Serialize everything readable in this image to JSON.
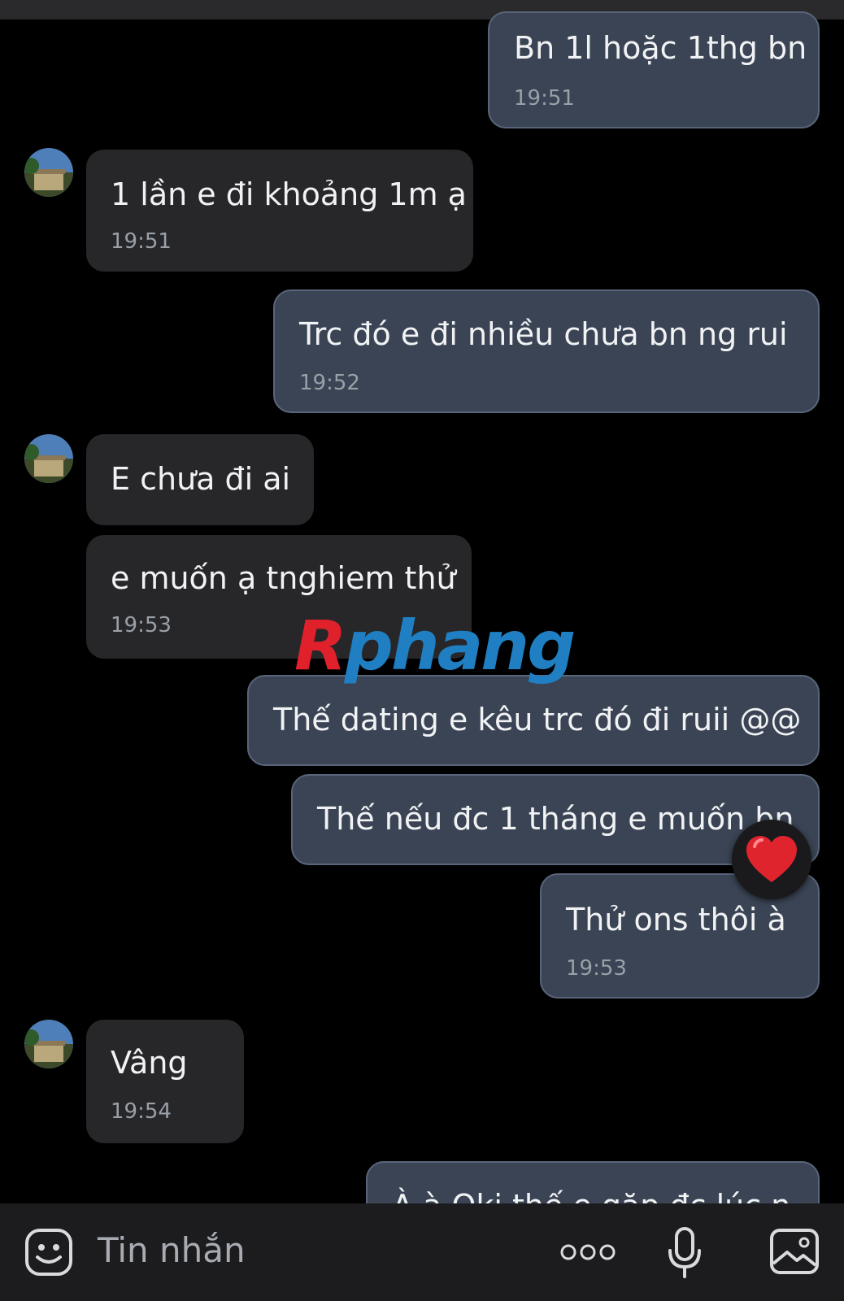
{
  "messages": [
    {
      "dir": "out",
      "text": "Bn 1l hoặc 1thg bn",
      "time": "19:51"
    },
    {
      "dir": "in",
      "text": "1 lần e đi khoảng 1m ạ",
      "time": "19:51"
    },
    {
      "dir": "out",
      "text": "Trc đó e đi nhiều chưa bn ng rui",
      "time": "19:52"
    },
    {
      "dir": "in",
      "text": "E chưa đi ai",
      "time": ""
    },
    {
      "dir": "in",
      "text": "e muốn ạ tnghiem thử",
      "time": "19:53"
    },
    {
      "dir": "out",
      "text": "Thế dating e kêu trc đó đi ruii @@",
      "time": ""
    },
    {
      "dir": "out",
      "text": "Thế nếu đc 1 tháng e muốn bn",
      "time": "",
      "reaction": "heart"
    },
    {
      "dir": "out",
      "text": "Thử ons thôi à",
      "time": "19:53"
    },
    {
      "dir": "in",
      "text": "Vâng",
      "time": "19:54"
    },
    {
      "dir": "out",
      "text": "À à Oki thế e gặp đc lúc n",
      "time": ""
    }
  ],
  "watermark": {
    "first": "R",
    "rest": "phang"
  },
  "composer": {
    "placeholder": "Tin nhắn"
  },
  "icons": [
    "sticker-icon",
    "more-icon",
    "microphone-icon",
    "image-icon",
    "heart-reaction-icon"
  ],
  "colors": {
    "outgoing_bubble": "#3a4454",
    "incoming_bubble": "#272729",
    "background": "#000000"
  }
}
